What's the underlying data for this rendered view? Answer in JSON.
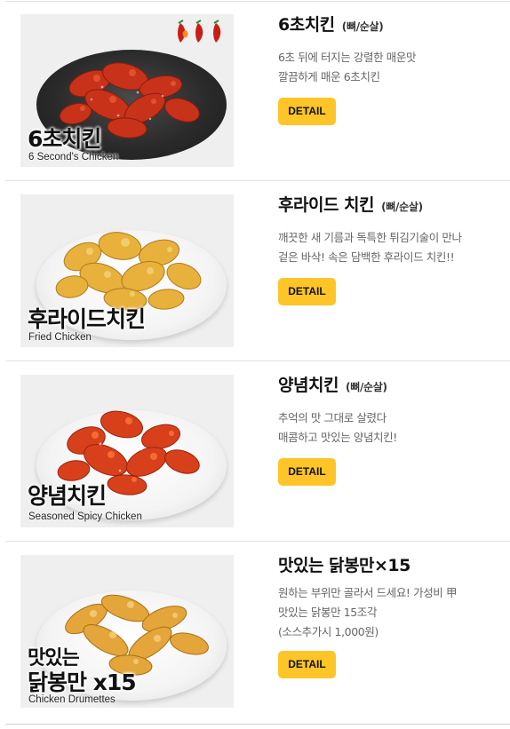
{
  "menu_items": [
    {
      "name": "6초치킨",
      "option": "(뼈/순살)",
      "description": [
        "6초 뒤에 터지는 강렬한 매운맛",
        "깔끔하게 매운 6초치킨"
      ],
      "button": "DETAIL",
      "thumb_title": "6초치킨",
      "thumb_subtitle": "6 Second's Chicken",
      "spice_icon": "chili-pepper-icon",
      "spice_level": 3
    },
    {
      "name": "후라이드 치킨",
      "option": "(뼈/순살)",
      "description": [
        "깨끗한 새 기름과 독특한 튀김기술이 만나",
        "겉은 바삭! 속은 담백한 후라이드 치킨!!"
      ],
      "button": "DETAIL",
      "thumb_title": "후라이드치킨",
      "thumb_subtitle": "Fried Chicken"
    },
    {
      "name": "양념치킨",
      "option": "(뼈/순살)",
      "description": [
        "추억의 맛 그대로 살렸다",
        "매콤하고 맛있는 양념치킨!"
      ],
      "button": "DETAIL",
      "thumb_title": "양념치킨",
      "thumb_subtitle": "Seasoned Spicy Chicken"
    },
    {
      "name": "맛있는 닭봉만×15",
      "option": "",
      "description": [
        "원하는 부위만 골라서 드세요! 가성비 甲",
        "맛있는 닭봉만 15조각",
        "(소스추가시 1,000원)"
      ],
      "button": "DETAIL",
      "thumb_title_line1": "맛있는",
      "thumb_title_line2": "닭봉만 x15",
      "thumb_subtitle": "Chicken Drumettes"
    }
  ],
  "colors": {
    "button_bg": "#fdc527",
    "divider": "#e2e2e2",
    "desc_text": "#666666",
    "spicy_sauce": "#c8321b",
    "fried_crust": "#e8b13c"
  }
}
